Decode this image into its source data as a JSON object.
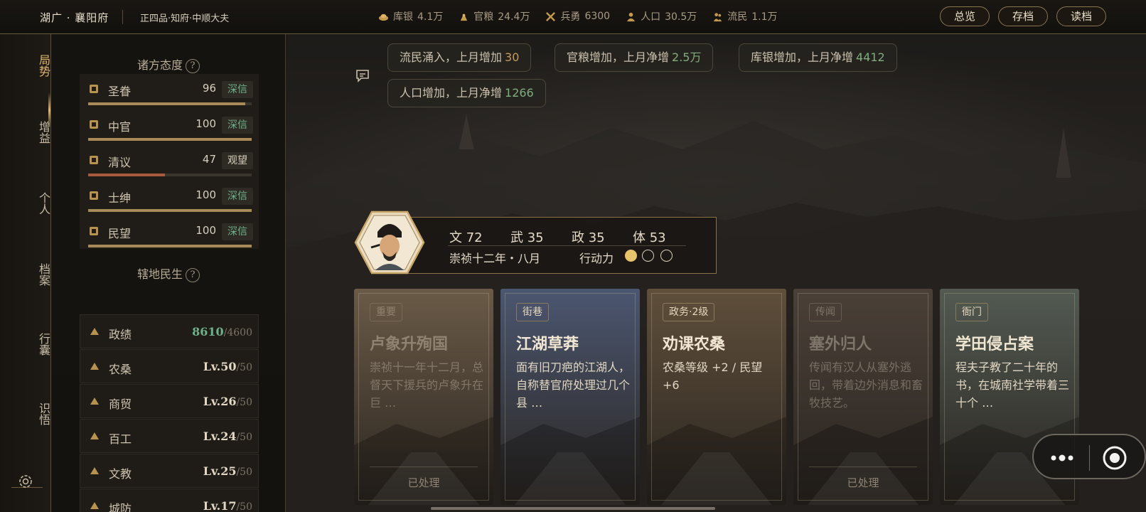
{
  "header": {
    "region": "湖广 · 襄阳府",
    "rank": "正四品·知府·中顺大夫",
    "resources": [
      {
        "icon": "silver-icon",
        "label": "库银",
        "value": "4.1万"
      },
      {
        "icon": "grain-icon",
        "label": "官粮",
        "value": "24.4万"
      },
      {
        "icon": "soldier-icon",
        "label": "兵勇",
        "value": "6300"
      },
      {
        "icon": "population-icon",
        "label": "人口",
        "value": "30.5万"
      },
      {
        "icon": "refugee-icon",
        "label": "流民",
        "value": "1.1万"
      }
    ],
    "buttons": {
      "overview": "总览",
      "save": "存档",
      "load": "读档"
    }
  },
  "nav": {
    "items": [
      {
        "label": "局势",
        "active": true
      },
      {
        "label": "增益"
      },
      {
        "label": "个人"
      },
      {
        "label": "档案"
      },
      {
        "label": "行囊"
      },
      {
        "label": "识悟"
      }
    ],
    "settings_icon": "gear-icon"
  },
  "attitudes": {
    "title": "诸方态度",
    "help": "?",
    "rows": [
      {
        "icon": "scroll-icon",
        "name": "圣眷",
        "value": "96",
        "level": 0.96,
        "status": "深信",
        "status_color": "#6fb08a",
        "bar_color": "#a88a57"
      },
      {
        "icon": "eunuch-icon",
        "name": "中官",
        "value": "100",
        "level": 1.0,
        "status": "深信",
        "status_color": "#6fb08a",
        "bar_color": "#a88a57"
      },
      {
        "icon": "scholar-icon",
        "name": "清议",
        "value": "47",
        "level": 0.47,
        "status": "观望",
        "status_color": "#d9cfbd",
        "bar_color": "#a8593b"
      },
      {
        "icon": "gentry-icon",
        "name": "士绅",
        "value": "100",
        "level": 1.0,
        "status": "深信",
        "status_color": "#6fb08a",
        "bar_color": "#a88a57"
      },
      {
        "icon": "people-icon",
        "name": "民望",
        "value": "100",
        "level": 1.0,
        "status": "深信",
        "status_color": "#6fb08a",
        "bar_color": "#a88a57"
      }
    ]
  },
  "domain": {
    "title": "辖地民生",
    "help": "?",
    "rows": [
      {
        "icon": "merit-icon",
        "name": "政绩",
        "value": "8610",
        "max": "/4600",
        "value_color": "#6fb08a"
      },
      {
        "icon": "farm-icon",
        "name": "农桑",
        "value": "Lv.50",
        "max": "/50"
      },
      {
        "icon": "trade-icon",
        "name": "商贸",
        "value": "Lv.26",
        "max": "/50"
      },
      {
        "icon": "craft-icon",
        "name": "百工",
        "value": "Lv.24",
        "max": "/50"
      },
      {
        "icon": "education-icon",
        "name": "文教",
        "value": "Lv.25",
        "max": "/50"
      },
      {
        "icon": "defense-icon",
        "name": "城防",
        "value": "Lv.17",
        "max": "/50"
      }
    ]
  },
  "notifications": [
    {
      "text": "流民涌入，上月增加",
      "num": "30",
      "color": "#c99a5c"
    },
    {
      "text": "官粮增加，上月净增",
      "num": "2.5万",
      "color": "#7fae7f"
    },
    {
      "text": "库银增加，上月净增",
      "num": "4412",
      "color": "#7fae7f"
    },
    {
      "text": "人口增加，上月净增",
      "num": "1266",
      "color": "#7fae7f"
    }
  ],
  "character": {
    "stats": [
      {
        "label": "文",
        "value": "72"
      },
      {
        "label": "武",
        "value": "35"
      },
      {
        "label": "政",
        "value": "35"
      },
      {
        "label": "体",
        "value": "53"
      }
    ],
    "date": "崇祯十二年・八月",
    "action_label": "行动力",
    "action_points": 1,
    "action_max": 3
  },
  "cards": [
    {
      "tag": "重要",
      "title": "卢象升殉国",
      "desc": "崇祯十一年十二月，总督天下援兵的卢象升在巨 …",
      "status": "已处理",
      "dim": true,
      "bg": "#6a5a47"
    },
    {
      "tag": "街巷",
      "title": "江湖草莽",
      "desc": "面有旧刀疤的江湖人，自称替官府处理过几个县 …",
      "status": "",
      "dim": false,
      "bg": "#4b5670"
    },
    {
      "tag": "政务·2级",
      "title": "劝课农桑",
      "desc": "农桑等级 +2 / 民望 +6",
      "status": "",
      "dim": false,
      "bg": "#5f4f3b"
    },
    {
      "tag": "传闻",
      "title": "塞外归人",
      "desc": "传闻有汉人从塞外逃回，带着边外消息和畜牧技艺。",
      "status": "已处理",
      "dim": true,
      "bg": "#4a4038"
    },
    {
      "tag": "衙门",
      "title": "学田侵占案",
      "desc": "程夫子教了二十年的书，在城南社学带着三十个 …",
      "status": "",
      "dim": false,
      "bg": "#525a52"
    }
  ]
}
